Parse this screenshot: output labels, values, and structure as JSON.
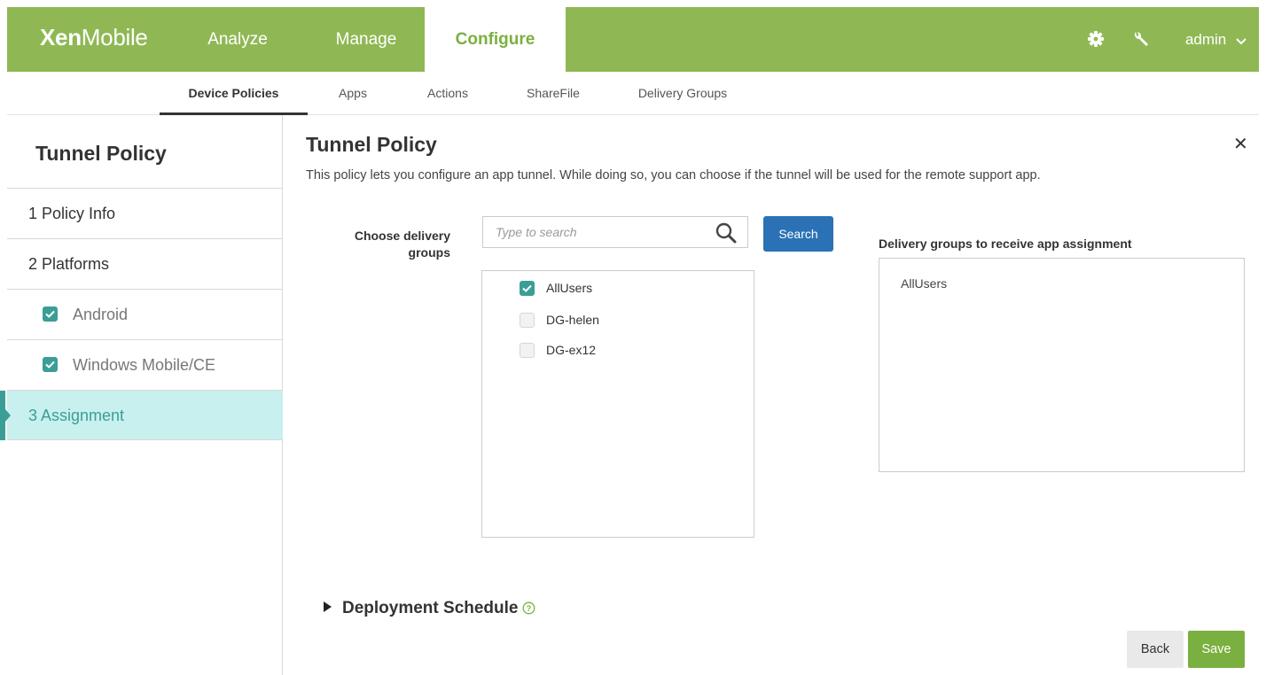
{
  "brand": {
    "bold": "Xen",
    "regular": "Mobile"
  },
  "topnav": [
    {
      "label": "Analyze",
      "active": false
    },
    {
      "label": "Manage",
      "active": false
    },
    {
      "label": "Configure",
      "active": true
    }
  ],
  "topbar_icons": [
    "gear-icon",
    "wrench-icon"
  ],
  "user": {
    "name": "admin"
  },
  "subnav": [
    {
      "label": "Device Policies",
      "active": true
    },
    {
      "label": "Apps",
      "active": false
    },
    {
      "label": "Actions",
      "active": false
    },
    {
      "label": "ShareFile",
      "active": false
    },
    {
      "label": "Delivery Groups",
      "active": false
    }
  ],
  "sidebar": {
    "title": "Tunnel Policy",
    "steps": [
      {
        "label": "1  Policy Info"
      },
      {
        "label": "2  Platforms"
      },
      {
        "label": "Android",
        "checked": true
      },
      {
        "label": "Windows Mobile/CE",
        "checked": true
      },
      {
        "label": "3  Assignment",
        "active": true
      }
    ]
  },
  "main": {
    "title": "Tunnel Policy",
    "description": "This policy lets you configure an app tunnel. While doing so, you can choose if the tunnel will be used for the remote support app.",
    "choose_label": "Choose delivery groups",
    "search_placeholder": "Type to search",
    "search_button": "Search",
    "groups": [
      {
        "label": "AllUsers",
        "checked": true
      },
      {
        "label": "DG-helen",
        "checked": false
      },
      {
        "label": "DG-ex12",
        "checked": false
      }
    ],
    "receive_label": "Delivery groups to receive app assignment",
    "receiving": [
      "AllUsers"
    ],
    "deployment_schedule": "Deployment Schedule",
    "back_button": "Back",
    "save_button": "Save"
  },
  "colors": {
    "brand_green": "#8fb854",
    "teal": "#3a9e97",
    "active_row": "#c8f0ee",
    "primary_blue": "#2a72b5",
    "save_green": "#7ab03f"
  }
}
